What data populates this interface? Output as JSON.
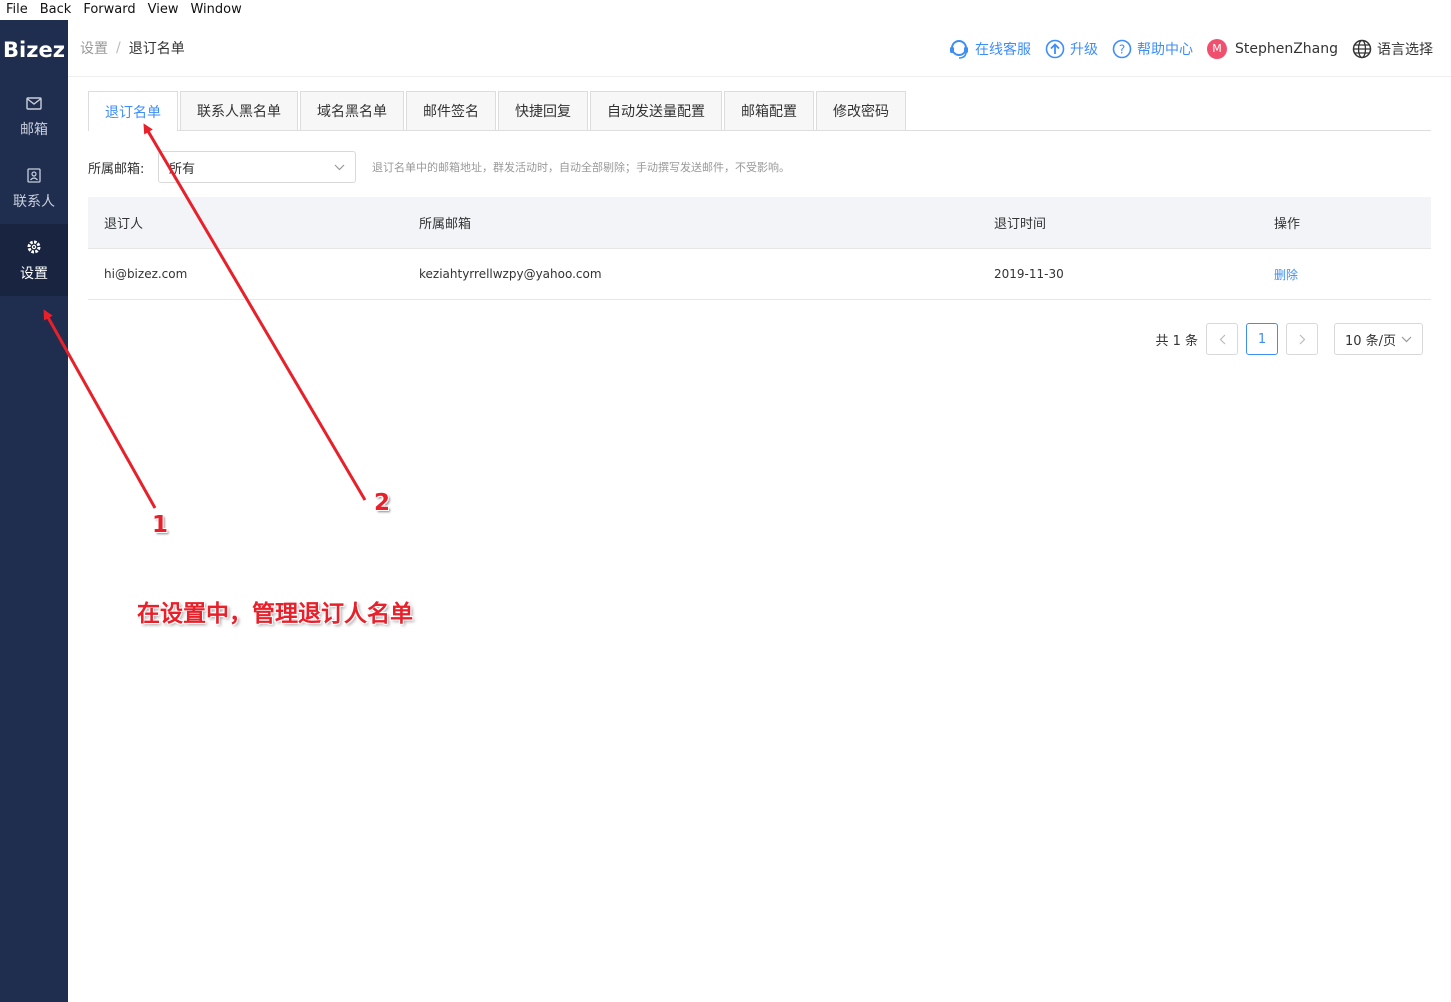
{
  "menubar": {
    "items": [
      "File",
      "Back",
      "Forward",
      "View",
      "Window"
    ]
  },
  "sidebar": {
    "logo": "Bizez",
    "items": [
      {
        "label": "邮箱",
        "icon": "mail-icon"
      },
      {
        "label": "联系人",
        "icon": "contact-icon"
      },
      {
        "label": "设置",
        "icon": "gear-icon",
        "active": true
      }
    ]
  },
  "header": {
    "breadcrumb": {
      "parent": "设置",
      "separator": "/",
      "current": "退订名单"
    },
    "support": "在线客服",
    "upgrade": "升级",
    "help": "帮助中心",
    "avatar_letter": "M",
    "user": "StephenZhang",
    "language": "语言选择"
  },
  "tabs": [
    "退订名单",
    "联系人黑名单",
    "域名黑名单",
    "邮件签名",
    "快捷回复",
    "自动发送量配置",
    "邮箱配置",
    "修改密码"
  ],
  "filter": {
    "label": "所属邮箱:",
    "value": "所有",
    "hint": "退订名单中的邮箱地址，群发活动时，自动全部剔除；手动撰写发送邮件，不受影响。"
  },
  "table": {
    "headers": [
      "退订人",
      "所属邮箱",
      "退订时间",
      "操作"
    ],
    "rows": [
      {
        "unsubscriber": "hi@bizez.com",
        "mailbox": "keziahtyrrellwzpy@yahoo.com",
        "time": "2019-11-30",
        "action": "删除"
      }
    ]
  },
  "pagination": {
    "total": "共 1 条",
    "prev": "<",
    "current": "1",
    "next": ">",
    "page_size": "10 条/页"
  },
  "annotations": {
    "label1": "1",
    "label2": "2",
    "caption": "在设置中，管理退订人名单",
    "color": "#e8202a"
  },
  "colors": {
    "accent": "#3e8ef7",
    "sidebar": "#1f2d4e"
  }
}
